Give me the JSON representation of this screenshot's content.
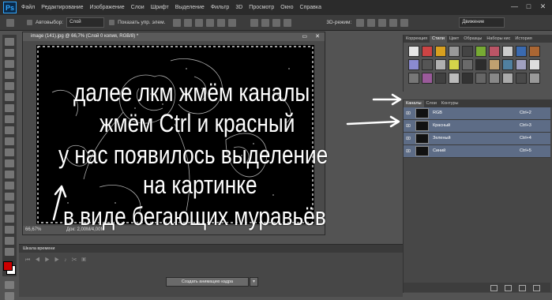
{
  "menubar": {
    "logo": "Ps",
    "items": [
      "Файл",
      "Редактирование",
      "Изображение",
      "Слои",
      "Шрифт",
      "Выделение",
      "Фильтр",
      "3D",
      "Просмотр",
      "Окно",
      "Справка"
    ],
    "win_controls": [
      "—",
      "□",
      "✕"
    ]
  },
  "optionsbar": {
    "autoselect_label": "Автовыбор:",
    "autoselect_value": "Слой",
    "show_controls_label": "Показать упр. элем.",
    "mode_3d": "3D-режим:",
    "workspace": "Движение"
  },
  "document": {
    "title": "image (141).jpg @ 66,7% (Слой 0 копия, RGB/8) *",
    "zoom": "66,67%",
    "doc_info": "Док: 2,00M/4,00M"
  },
  "panel_top": {
    "tabs": [
      "Коррекция",
      "Стили",
      "Цвет",
      "Образцы",
      "Наборы кис",
      "История"
    ],
    "active_tab": "Стили"
  },
  "channels_panel": {
    "tabs": [
      "Каналы",
      "Слои",
      "Контуры"
    ],
    "active_tab": "Каналы",
    "channels": [
      {
        "name": "RGB",
        "shortcut": "Ctrl+2"
      },
      {
        "name": "Красный",
        "shortcut": "Ctrl+3"
      },
      {
        "name": "Зеленый",
        "shortcut": "Ctrl+4"
      },
      {
        "name": "Синий",
        "shortcut": "Ctrl+5"
      }
    ]
  },
  "timeline": {
    "tab": "Шкала времени",
    "create_button": "Создать анимацию кадра"
  },
  "overlay": {
    "line1": "далее  лкм жмём каналы",
    "line2": "жмём Ctrl и красный",
    "line3": "у нас появилось выделение",
    "line4": "на картинке",
    "line5": "в виде бегающих муравьёв"
  },
  "colors": {
    "foreground": "#cc0000",
    "background": "#ffffff",
    "channel_highlight": "#5d6c86"
  }
}
